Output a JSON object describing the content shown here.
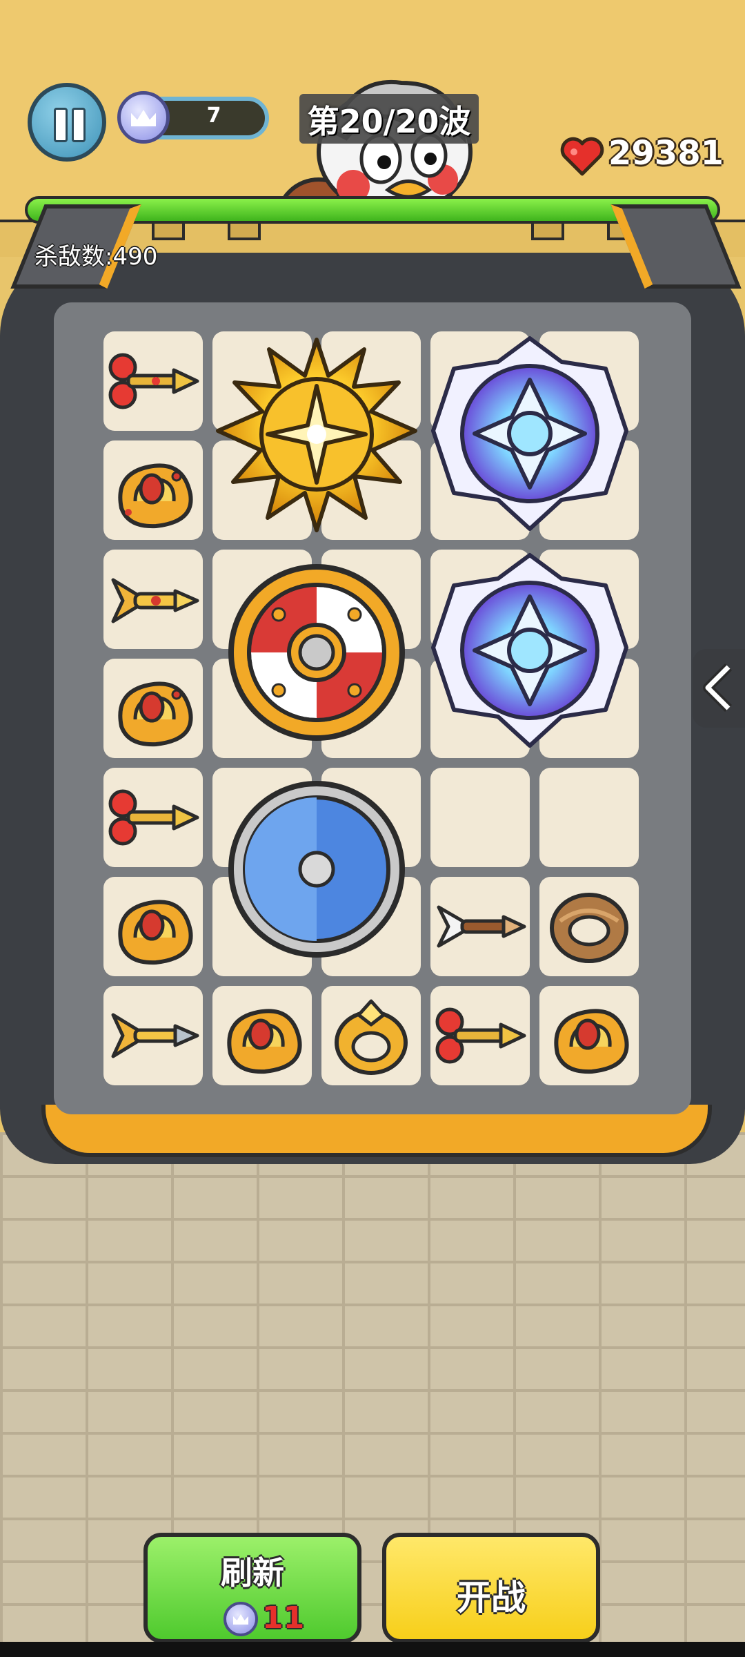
{
  "hud": {
    "crown_count": "7",
    "wave_label": "第20/20波",
    "hp_value": "29381",
    "kills_label": "杀敌数:490",
    "hp_fraction": 1.0
  },
  "colors": {
    "accent_green": "#4fca2e",
    "accent_yellow": "#f7cf1a",
    "heart_red": "#e5302b",
    "crown_blue": "#8b8fe6"
  },
  "board": {
    "icons": [
      "wind-key-dart-icon",
      "crown-ring-icon",
      "golden-sun-medallion-icon",
      "crystal-rune-icon",
      "golden-dart-icon",
      "red-white-shield-icon",
      "blue-shield-icon",
      "white-arrow-icon",
      "wooden-ring-icon",
      "gold-ring-icon",
      "arrow-dart-icon",
      "empty-slot"
    ]
  },
  "buttons": {
    "refresh_label": "刷新",
    "refresh_cost": "11",
    "battle_label": "开战"
  }
}
